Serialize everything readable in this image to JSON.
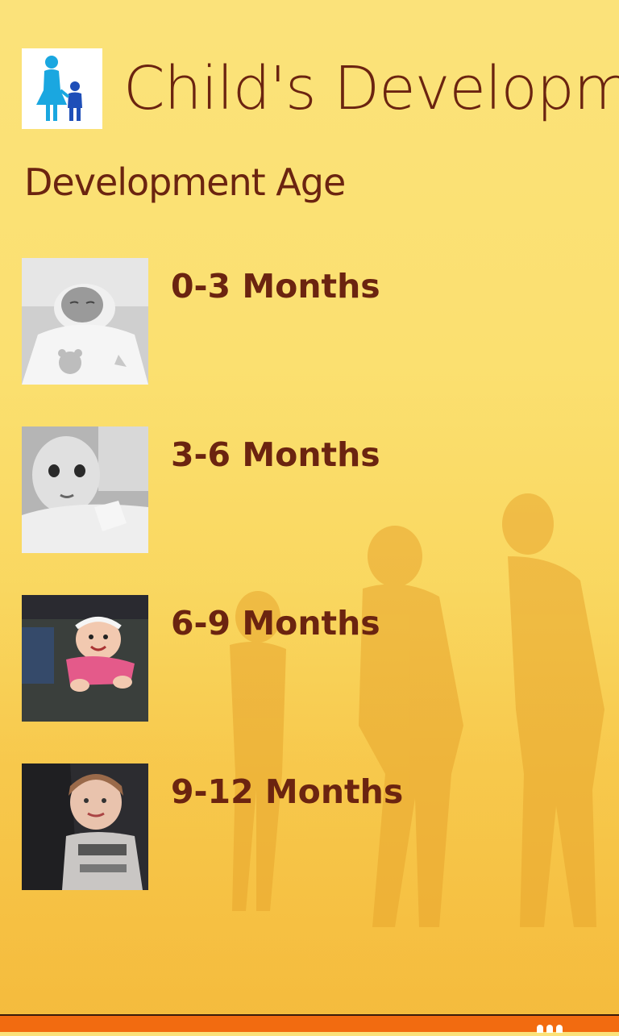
{
  "app": {
    "title": "Child's Development",
    "icon": "parent-child-icon"
  },
  "page": {
    "title": "Development Age"
  },
  "ages": [
    {
      "label": "0-3 Months",
      "image": "sleeping-newborn-photo"
    },
    {
      "label": "3-6 Months",
      "image": "infant-lying-photo"
    },
    {
      "label": "6-9 Months",
      "image": "crawling-baby-photo"
    },
    {
      "label": "9-12 Months",
      "image": "toddler-car-seat-photo"
    }
  ],
  "app_bar": {
    "more_icon": "ellipsis-icon"
  },
  "colors": {
    "text": "#6b2410",
    "background": "#fbe070",
    "app_bar": "#f26b10"
  }
}
